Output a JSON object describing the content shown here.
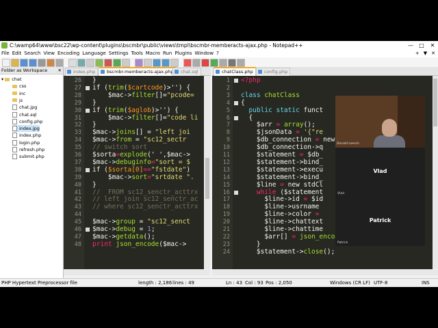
{
  "window": {
    "title": "C:\\wamp64\\www\\bsc22\\wp-content\\plugins\\bscmbr\\public\\views\\tmpl\\bscmbr-memberacts-ajax.php - Notepad++",
    "minimize": "—",
    "maximize": "□",
    "close": "✕"
  },
  "menu": [
    "File",
    "Edit",
    "Search",
    "View",
    "Encoding",
    "Language",
    "Settings",
    "Tools",
    "Macro",
    "Run",
    "Plugins",
    "Window",
    "?"
  ],
  "menu_right": [
    "+",
    "▼",
    "✕"
  ],
  "folder_pane": {
    "title": "Folder as Workspace",
    "close": "✕",
    "items": [
      {
        "label": "chat",
        "kind": "folder",
        "indent": 0,
        "selected": false
      },
      {
        "label": "css",
        "kind": "folder",
        "indent": 1,
        "selected": false
      },
      {
        "label": "inc",
        "kind": "folder",
        "indent": 1,
        "selected": false
      },
      {
        "label": "js",
        "kind": "folder",
        "indent": 1,
        "selected": false
      },
      {
        "label": "chat.jpg",
        "kind": "file",
        "indent": 1,
        "selected": false
      },
      {
        "label": "chat.sql",
        "kind": "file",
        "indent": 1,
        "selected": false
      },
      {
        "label": "config.php",
        "kind": "file",
        "indent": 1,
        "selected": false
      },
      {
        "label": "index.jpg",
        "kind": "file",
        "indent": 1,
        "selected": true
      },
      {
        "label": "index.php",
        "kind": "file",
        "indent": 1,
        "selected": false
      },
      {
        "label": "login.php",
        "kind": "file",
        "indent": 1,
        "selected": false
      },
      {
        "label": "refresh.php",
        "kind": "file",
        "indent": 1,
        "selected": false
      },
      {
        "label": "submit.php",
        "kind": "file",
        "indent": 1,
        "selected": false
      }
    ]
  },
  "left_tabs": [
    {
      "label": "index.php",
      "active": false
    },
    {
      "label": "bscmbr-memberacts-ajax.php",
      "active": true
    },
    {
      "label": "chat.sql",
      "active": false
    }
  ],
  "right_tabs": [
    {
      "label": "chatClass.php",
      "active": true
    },
    {
      "label": "config.php",
      "active": false
    }
  ],
  "left_editor": {
    "first_line": 26,
    "lines": [
      [
        [
          "}",
          "p"
        ]
      ],
      [
        [
          "if (",
          "p"
        ],
        [
          "trim",
          "f"
        ],
        [
          "(",
          "p"
        ],
        [
          "$cartcode",
          "v"
        ],
        [
          ")>'') {",
          "p"
        ]
      ],
      [
        [
          "    $mac->",
          "p"
        ],
        [
          "filter",
          "f"
        ],
        [
          "[]=",
          "p"
        ],
        [
          "\"pcode=",
          "s"
        ]
      ],
      [
        [
          "}",
          "p"
        ]
      ],
      [
        [
          "if (",
          "p"
        ],
        [
          "trim",
          "f"
        ],
        [
          "(",
          "p"
        ],
        [
          "$aglob",
          "v"
        ],
        [
          ")>'') {",
          "p"
        ]
      ],
      [
        [
          "    $mac->",
          "p"
        ],
        [
          "filter",
          "f"
        ],
        [
          "[]=",
          "p"
        ],
        [
          "\"code li",
          "s"
        ]
      ],
      [
        [
          "}",
          "p"
        ]
      ],
      [
        [
          "$mac->",
          "p"
        ],
        [
          "joins",
          "f"
        ],
        [
          "[] = ",
          "p"
        ],
        [
          "\"left joi",
          "s"
        ]
      ],
      [
        [
          "$mac->",
          "p"
        ],
        [
          "from",
          "f"
        ],
        [
          " = ",
          "p"
        ],
        [
          "\"sc12_sectr",
          "s"
        ]
      ],
      [
        [
          "// switch sort",
          "c"
        ]
      ],
      [
        [
          "$sorta",
          "p"
        ],
        [
          "=",
          "k"
        ],
        [
          "explode",
          "f"
        ],
        [
          "(' ',$mac->",
          "p"
        ]
      ],
      [
        [
          "$mac->",
          "p"
        ],
        [
          "debuginfo",
          "f"
        ],
        [
          "=",
          "k"
        ],
        [
          "\"sort = $",
          "s"
        ]
      ],
      [
        [
          "if (",
          "p"
        ],
        [
          "$sorta[0]",
          "v"
        ],
        [
          "==",
          "k"
        ],
        [
          "\"fstdate\"",
          "s"
        ],
        [
          ")",
          "p"
        ]
      ],
      [
        [
          "    $mac->",
          "p"
        ],
        [
          "sort",
          "f"
        ],
        [
          "=",
          "k"
        ],
        [
          "\"srtdate \".",
          "s"
        ]
      ],
      [
        [
          "}",
          "p"
        ]
      ],
      [
        [
          "//  FROM sc12_senctr_acttrx",
          "c"
        ]
      ],
      [
        [
          "// left join sc12_senctr_ac",
          "c"
        ]
      ],
      [
        [
          "// where sc12_senctr_acttrx",
          "c"
        ]
      ],
      [
        [
          "",
          "p"
        ]
      ],
      [
        [
          "$mac->",
          "p"
        ],
        [
          "group",
          "f"
        ],
        [
          " = ",
          "p"
        ],
        [
          "\"sc12_senct",
          "s"
        ]
      ],
      [
        [
          "$mac->",
          "p"
        ],
        [
          "debug",
          "f"
        ],
        [
          " = ",
          "p"
        ],
        [
          "1",
          "n"
        ],
        [
          ";",
          "p"
        ]
      ],
      [
        [
          "$mac->",
          "p"
        ],
        [
          "getdata",
          "f"
        ],
        [
          "();",
          "p"
        ]
      ],
      [
        [
          "print ",
          "k"
        ],
        [
          "json_encode",
          "f"
        ],
        [
          "($mac->",
          "p"
        ]
      ]
    ]
  },
  "right_editor": {
    "first_line": 1,
    "lines": [
      [
        [
          "<?php",
          "k"
        ]
      ],
      [
        [
          "",
          "p"
        ]
      ],
      [
        [
          "class ",
          "t"
        ],
        [
          "chatClass",
          "g"
        ]
      ],
      [
        [
          "{",
          "p"
        ]
      ],
      [
        [
          "  public static ",
          "t"
        ],
        [
          "funct",
          "p"
        ]
      ],
      [
        [
          "  {",
          "p"
        ]
      ],
      [
        [
          "    $arr",
          "p"
        ],
        [
          " = ",
          "k"
        ],
        [
          "array",
          "f"
        ],
        [
          "();",
          "p"
        ]
      ],
      [
        [
          "    $jsonData",
          "p"
        ],
        [
          " = ",
          "k"
        ],
        [
          "'{\"re",
          "s"
        ]
      ],
      [
        [
          "    $db_connection",
          "p"
        ],
        [
          " = ",
          "k"
        ],
        [
          "new mysqli(",
          "p"
        ]
      ],
      [
        [
          "    $db_connection",
          "p"
        ],
        [
          "->q",
          "p"
        ]
      ],
      [
        [
          "    $statement",
          "p"
        ],
        [
          " = ",
          "k"
        ],
        [
          "$db_",
          "p"
        ]
      ],
      [
        [
          "    $statement",
          "p"
        ],
        [
          "->bind_",
          "p"
        ]
      ],
      [
        [
          "    $statement",
          "p"
        ],
        [
          "->execu",
          "p"
        ]
      ],
      [
        [
          "    $statement",
          "p"
        ],
        [
          "->bind_",
          "p"
        ]
      ],
      [
        [
          "    $line",
          "p"
        ],
        [
          " = ",
          "k"
        ],
        [
          "new stdCl",
          "p"
        ]
      ],
      [
        [
          "    while",
          "k"
        ],
        [
          " ($statement",
          "p"
        ]
      ],
      [
        [
          "      $line->",
          "p"
        ],
        [
          "id",
          "p"
        ],
        [
          " = ",
          "k"
        ],
        [
          "$id",
          "p"
        ]
      ],
      [
        [
          "      $line->",
          "p"
        ],
        [
          "usrname",
          "p"
        ]
      ],
      [
        [
          "      $line->",
          "p"
        ],
        [
          "color",
          "p"
        ],
        [
          " = ",
          "k"
        ]
      ],
      [
        [
          "      $line->",
          "p"
        ],
        [
          "chattext",
          "p"
        ]
      ],
      [
        [
          "      $line->",
          "p"
        ],
        [
          "chattime",
          "p"
        ]
      ],
      [
        [
          "      $arr[]",
          "p"
        ],
        [
          " = ",
          "k"
        ],
        [
          "json_encode",
          "f"
        ],
        [
          "($line);",
          "p"
        ]
      ],
      [
        [
          "    }",
          "p"
        ]
      ],
      [
        [
          "    $statement",
          "p"
        ],
        [
          "->",
          "p"
        ],
        [
          "close",
          "f"
        ],
        [
          "();",
          "p"
        ]
      ]
    ]
  },
  "video": {
    "cam_label": "Donald Loesch",
    "participants": [
      "Vlad",
      "Patrick"
    ],
    "small_labels": [
      "Vlad",
      "Patrick"
    ]
  },
  "status": {
    "filetype": "PHP Hypertext Preprocessor file",
    "length": "length : 2,186",
    "lines": "lines : 49",
    "ln": "Ln : 43",
    "col": "Col : 93",
    "pos": "Pos : 2,050",
    "eol": "Windows (CR LF)",
    "encoding": "UTF-8",
    "ins": "INS"
  },
  "colors": {
    "editor_bg": "#272822",
    "plain": "#f8f8f2",
    "keyword": "#f92672",
    "func": "#a6e22e",
    "string": "#e6db74",
    "comment": "#75715e",
    "number": "#ae81ff",
    "type": "#66d9ef",
    "var": "#fd971f",
    "classname": "#a6e22e",
    "active_tab_accent": "#f5a623"
  }
}
